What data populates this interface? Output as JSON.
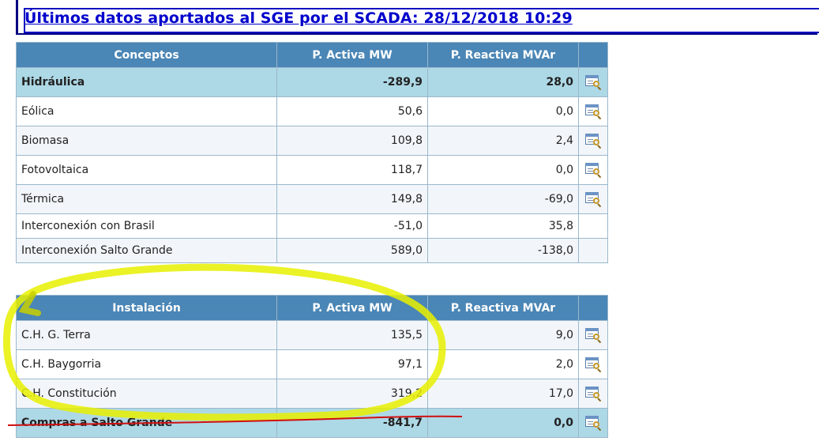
{
  "title": "Últimos datos aportados al SGE por el SCADA: 28/12/2018 10:29",
  "table1": {
    "headers": [
      "Conceptos",
      "P. Activa MW",
      "P. Reactiva MVAr"
    ],
    "rows": [
      {
        "concept": "Hidráulica",
        "active": "-289,9",
        "reactive": "28,0",
        "has_icon": true,
        "highlight": true
      },
      {
        "concept": "Eólica",
        "active": "50,6",
        "reactive": "0,0",
        "has_icon": true
      },
      {
        "concept": "Biomasa",
        "active": "109,8",
        "reactive": "2,4",
        "has_icon": true
      },
      {
        "concept": "Fotovoltaica",
        "active": "118,7",
        "reactive": "0,0",
        "has_icon": true
      },
      {
        "concept": "Térmica",
        "active": "149,8",
        "reactive": "-69,0",
        "has_icon": true
      },
      {
        "concept": "Interconexión con Brasil",
        "active": "-51,0",
        "reactive": "35,8",
        "has_icon": false
      },
      {
        "concept": "Interconexión Salto Grande",
        "active": "589,0",
        "reactive": "-138,0",
        "has_icon": false
      }
    ]
  },
  "table2": {
    "headers": [
      "Instalación",
      "P. Activa MW",
      "P. Reactiva MVAr"
    ],
    "rows": [
      {
        "concept": "C.H. G. Terra",
        "active": "135,5",
        "reactive": "9,0",
        "has_icon": true
      },
      {
        "concept": "C.H. Baygorria",
        "active": "97,1",
        "reactive": "2,0",
        "has_icon": true
      },
      {
        "concept": "C.H. Constitución",
        "active": "319,2",
        "reactive": "17,0",
        "has_icon": true
      },
      {
        "concept": "Compras a Salto Grande",
        "active": "-841,7",
        "reactive": "0,0",
        "has_icon": true,
        "highlight": true
      }
    ]
  },
  "icons": {
    "detail": "detail-view-icon"
  },
  "colors": {
    "header": "#4a86b6",
    "highlight_row": "#add8e6",
    "title": "#0000cc",
    "marker": "#e8f000",
    "strike": "#d01010"
  }
}
